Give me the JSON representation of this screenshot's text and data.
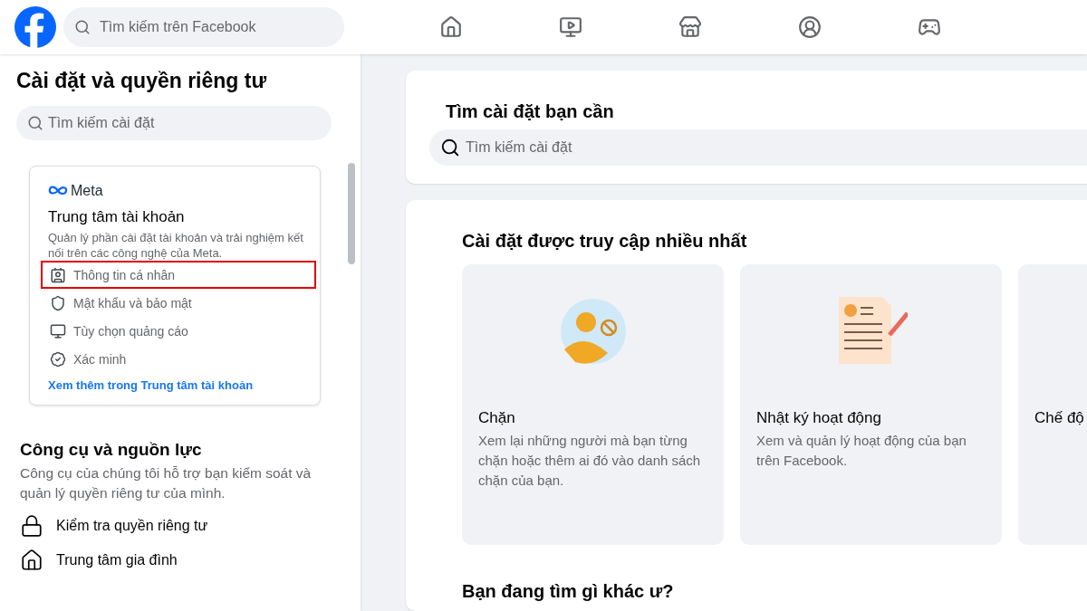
{
  "topbar": {
    "search": {
      "placeholder": "Tìm kiếm trên Facebook"
    },
    "nav": [
      {
        "kind": "home"
      },
      {
        "kind": "video"
      },
      {
        "kind": "marketplace"
      },
      {
        "kind": "groups"
      },
      {
        "kind": "gaming"
      }
    ]
  },
  "sidebar": {
    "title": "Cài đặt và quyền riêng tư",
    "search": {
      "placeholder": "Tìm kiếm cài đặt"
    },
    "accounts_center": {
      "brand": "Meta",
      "title": "Trung tâm tài khoản",
      "description": "Quản lý phần cài đặt tài khoản và trải nghiệm kết nối trên các công nghệ của Meta.",
      "items": [
        {
          "kind": "profile",
          "label": "Thông tin cá nhân",
          "highlighted": true
        },
        {
          "kind": "security",
          "label": "Mật khẩu và bảo mật",
          "highlighted": false
        },
        {
          "kind": "ads",
          "label": "Tùy chọn quảng cáo",
          "highlighted": false
        },
        {
          "kind": "verify",
          "label": "Xác minh",
          "highlighted": false
        }
      ],
      "link": "Xem thêm trong Trung tâm tài khoản"
    },
    "tools": {
      "title": "Công cụ và nguồn lực",
      "description": "Công cụ của chúng tôi hỗ trợ bạn kiểm soát và quản lý quyền riêng tư của mình.",
      "items": [
        {
          "kind": "lock",
          "label": "Kiểm tra quyền riêng tư"
        },
        {
          "kind": "family",
          "label": "Trung tâm gia đình"
        }
      ]
    }
  },
  "main": {
    "search_card": {
      "title": "Tìm cài đặt bạn cần",
      "search": {
        "placeholder": "Tìm kiếm cài đặt"
      }
    },
    "most_visited": {
      "title": "Cài đặt được truy cập nhiều nhất",
      "tiles": [
        {
          "kind": "blocking",
          "title": "Chặn",
          "description": "Xem lại những người mà bạn từng chặn hoặc thêm ai đó vào danh sách chặn của bạn."
        },
        {
          "kind": "activity",
          "title": "Nhật ký hoạt động",
          "description": "Xem và quản lý hoạt động của bạn trên Facebook."
        },
        {
          "kind": "other",
          "title": "Chế độ"
        }
      ]
    },
    "more": {
      "title": "Bạn đang tìm gì khác ư?"
    }
  }
}
